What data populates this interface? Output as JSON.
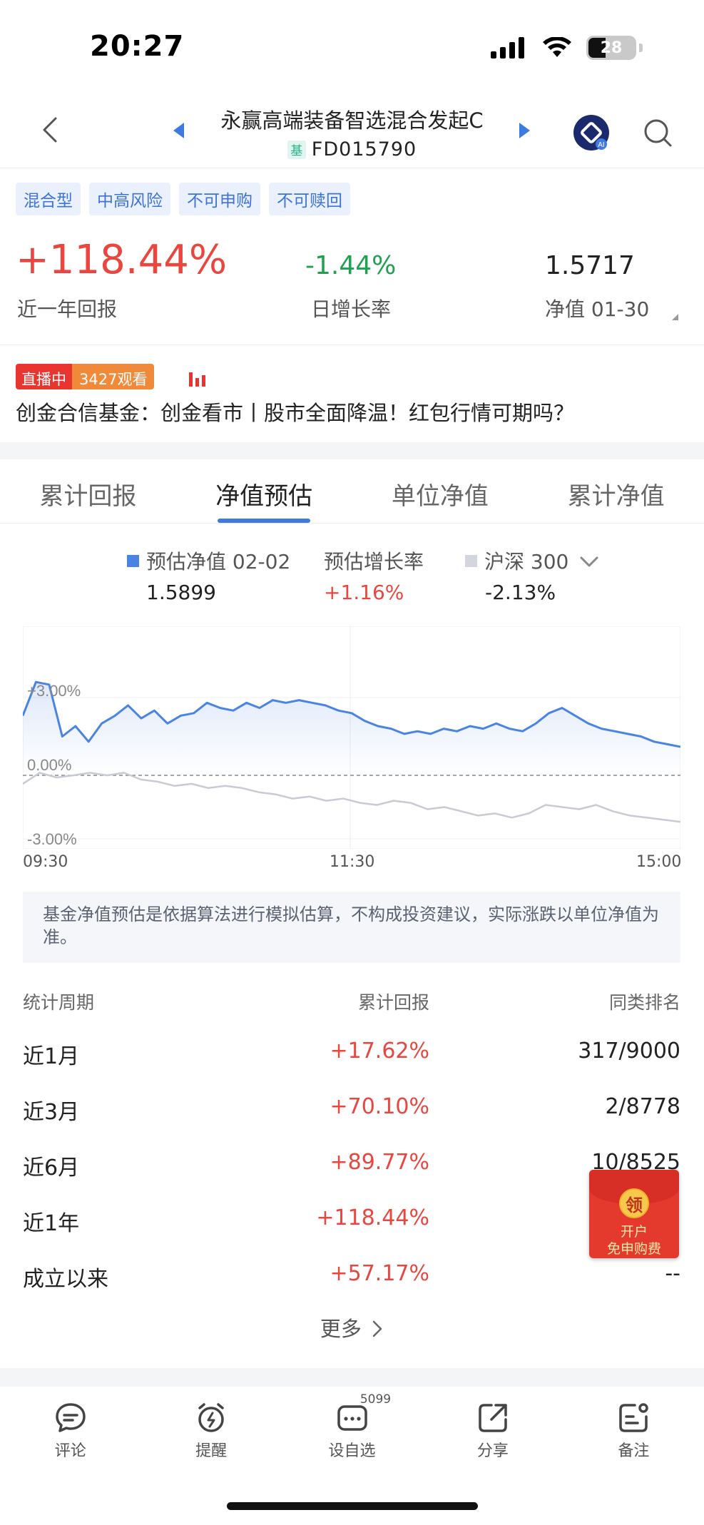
{
  "status": {
    "time": "20:27",
    "battery": "28"
  },
  "nav": {
    "title": "永赢高端装备智选混合发起C",
    "code_badge": "基",
    "code": "FD015790"
  },
  "tags": [
    "混合型",
    "中高风险",
    "不可申购",
    "不可赎回"
  ],
  "metrics": {
    "year_return": {
      "value": "+118.44%",
      "label": "近一年回报"
    },
    "daily": {
      "value": "-1.44%",
      "label": "日增长率"
    },
    "nav": {
      "value": "1.5717",
      "label": "净值 01-30"
    }
  },
  "live": {
    "status": "直播中",
    "viewers": "3427观看",
    "title": "创金合信基金：创金看市丨股市全面降温！红包行情可期吗？"
  },
  "tabs": [
    "累计回报",
    "净值预估",
    "单位净值",
    "累计净值"
  ],
  "legend": {
    "est_label": "预估净值 02-02",
    "est_value": "1.5899",
    "rate_label": "预估增长率",
    "rate_value": "+1.16%",
    "index_label": "沪深 300",
    "index_value": "-2.13%"
  },
  "chart_data": {
    "type": "line",
    "x_ticks": [
      "09:30",
      "11:30",
      "15:00"
    ],
    "y_ticks": [
      "+3.00%",
      "0.00%",
      "-3.00%"
    ],
    "ylim": [
      -3.0,
      3.0
    ],
    "grid": true,
    "series": [
      {
        "name": "预估净值",
        "color": "#4a84e3",
        "values": [
          2.3,
          3.6,
          3.5,
          1.5,
          1.9,
          1.3,
          2.0,
          2.3,
          2.7,
          2.2,
          2.5,
          2.0,
          2.3,
          2.4,
          2.8,
          2.6,
          2.5,
          2.8,
          2.6,
          2.9,
          2.8,
          2.9,
          2.8,
          2.7,
          2.5,
          2.4,
          2.1,
          1.9,
          1.8,
          1.6,
          1.7,
          1.6,
          1.8,
          1.7,
          1.9,
          1.8,
          2.0,
          1.8,
          1.7,
          2.0,
          2.4,
          2.6,
          2.3,
          2.0,
          1.8,
          1.7,
          1.6,
          1.5,
          1.3,
          1.2,
          1.1
        ]
      },
      {
        "name": "沪深 300",
        "color": "#c8cbd3",
        "values": [
          -0.4,
          0.1,
          -0.1,
          0.0,
          0.1,
          0.0,
          0.1,
          -0.2,
          -0.3,
          -0.5,
          -0.4,
          -0.6,
          -0.5,
          -0.6,
          -0.8,
          -0.9,
          -1.1,
          -1.0,
          -1.2,
          -1.1,
          -1.3,
          -1.4,
          -1.2,
          -1.3,
          -1.6,
          -1.5,
          -1.7,
          -1.9,
          -1.8,
          -2.0,
          -1.8,
          -1.4,
          -1.5,
          -1.6,
          -1.4,
          -1.7,
          -1.9,
          -2.0,
          -2.1,
          -2.2
        ]
      }
    ]
  },
  "notice": "基金净值预估是依据算法进行模拟估算，不构成投资建议，实际涨跌以单位净值为准。",
  "table": {
    "headers": [
      "统计周期",
      "累计回报",
      "同类排名"
    ],
    "rows": [
      {
        "period": "近1月",
        "ret": "+17.62%",
        "rank": "317/9000"
      },
      {
        "period": "近3月",
        "ret": "+70.10%",
        "rank": "2/8778"
      },
      {
        "period": "近6月",
        "ret": "+89.77%",
        "rank": "10/8525"
      },
      {
        "period": "近1年",
        "ret": "+118.44%",
        "rank": ""
      },
      {
        "period": "成立以来",
        "ret": "+57.17%",
        "rank": "--"
      }
    ]
  },
  "more": "更多",
  "redpack": {
    "coin": "领",
    "line1": "开户",
    "line2": "免申购费"
  },
  "bottom_bar": {
    "items": [
      {
        "label": "评论",
        "icon": "comment-icon"
      },
      {
        "label": "提醒",
        "icon": "alarm-icon"
      },
      {
        "label": "设自选",
        "icon": "watchlist-icon",
        "badge": "5099"
      },
      {
        "label": "分享",
        "icon": "share-icon"
      },
      {
        "label": "备注",
        "icon": "note-icon"
      }
    ]
  }
}
